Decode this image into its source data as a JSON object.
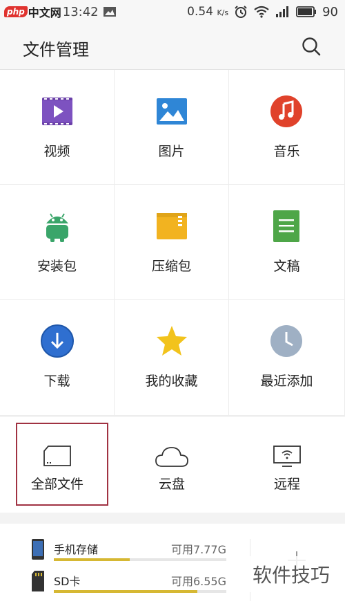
{
  "watermark": {
    "php": "php",
    "cn": "中文网",
    "bottom": "软件技巧"
  },
  "status_bar": {
    "time": "13:42",
    "speed": "0.54",
    "speed_unit": "K/s",
    "battery": "90"
  },
  "header": {
    "title": "文件管理",
    "search_icon": "search-icon"
  },
  "categories": [
    {
      "label": "视频",
      "icon": "video-icon",
      "color": "#6a3fa8"
    },
    {
      "label": "图片",
      "icon": "image-icon",
      "color": "#2f86d6"
    },
    {
      "label": "音乐",
      "icon": "music-icon",
      "color": "#e0422b"
    },
    {
      "label": "安装包",
      "icon": "android-icon",
      "color": "#3aa56a"
    },
    {
      "label": "压缩包",
      "icon": "zip-icon",
      "color": "#f2b320"
    },
    {
      "label": "文稿",
      "icon": "document-icon",
      "color": "#4ea648"
    },
    {
      "label": "下载",
      "icon": "download-icon",
      "color": "#2f6fd0"
    },
    {
      "label": "我的收藏",
      "icon": "star-icon",
      "color": "#f2c31c"
    },
    {
      "label": "最近添加",
      "icon": "clock-icon",
      "color": "#9fb0c4"
    }
  ],
  "locations": [
    {
      "label": "全部文件",
      "icon": "sd-card-outline-icon",
      "selected": true
    },
    {
      "label": "云盘",
      "icon": "cloud-icon",
      "selected": false
    },
    {
      "label": "远程",
      "icon": "remote-monitor-icon",
      "selected": false
    }
  ],
  "storage": [
    {
      "name": "手机存储",
      "free": "可用7.77G",
      "icon": "phone-icon",
      "used_fraction": 0.44
    },
    {
      "name": "SD卡",
      "free": "可用6.55G",
      "icon": "sd-card-icon",
      "used_fraction": 0.83
    }
  ],
  "colors": {
    "accent_bar": "#d6b833",
    "highlight_border": "#a03242"
  }
}
